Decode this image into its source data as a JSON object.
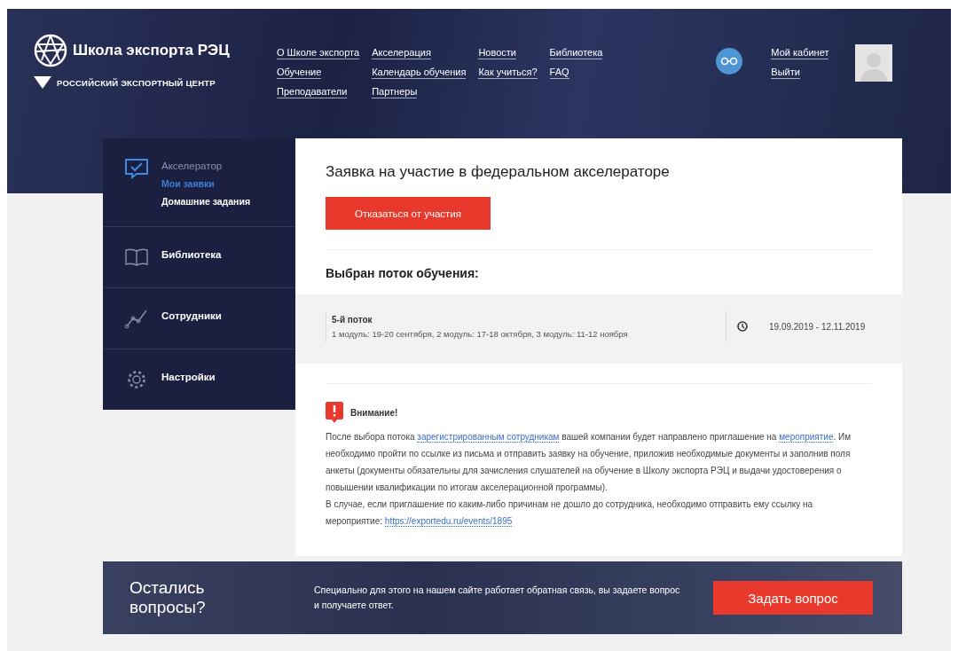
{
  "header": {
    "logo_title": "Школа экспорта РЭЦ",
    "logo_subtitle": "РОССИЙСКИЙ ЭКСПОРТНЫЙ ЦЕНТР",
    "nav_columns": [
      [
        "О Школе экспорта",
        "Обучение",
        "Преподаватели"
      ],
      [
        "Акселерация",
        "Календарь обучения",
        "Партнеры"
      ],
      [
        "Новости",
        "Как учиться?"
      ],
      [
        "Библиотека",
        "FAQ"
      ]
    ],
    "user_links": [
      "Мой кабинет",
      "Выйти"
    ]
  },
  "sidebar": {
    "items": [
      {
        "label": "Акселератор",
        "selected": true,
        "children": [
          {
            "label": "Мои заявки",
            "selected": true
          },
          {
            "label": "Домашние задания",
            "selected": false
          }
        ]
      },
      {
        "label": "Библиотека",
        "selected": false
      },
      {
        "label": "Сотрудники",
        "selected": false
      },
      {
        "label": "Настройки",
        "selected": false
      }
    ]
  },
  "main": {
    "title": "Заявка на участие в федеральном акселераторе",
    "cancel_button": "Отказаться от участия",
    "stream_heading": "Выбран поток обучения:",
    "stream": {
      "name": "5-й поток",
      "modules": "1 модуль: 19-20 сентября, 2 модуль: 17-18 октября, 3 модуль: 11-12 ноября",
      "dates": "19.09.2019 - 12.11.2019"
    },
    "notice": {
      "title": "Внимание!",
      "paragraphs": [
        [
          {
            "text": "После выбора потока "
          },
          {
            "text": "зарегистрированным сотрудникам",
            "link": true
          },
          {
            "text": " вашей компании будет направлено приглашение на "
          },
          {
            "text": "мероприятие",
            "link": true
          },
          {
            "text": ". Им необходимо пройти по ссылке из письма и отправить заявку на обучение, приложив необходимые документы и заполнив поля анкеты (документы обязательны для зачисления слушателей на обучение в Школу экспорта РЭЦ и выдачи удостоверения о повышении квалификации по итогам акселерационной программы)."
          }
        ],
        [
          {
            "text": "В случае, если приглашение по каким-либо причинам не дошло до сотрудника, необходимо отправить ему ссылку на мероприятие: "
          },
          {
            "text": "https://exportedu.ru/events/1895",
            "link": true
          }
        ]
      ]
    }
  },
  "banner": {
    "title": "Остались вопросы?",
    "text": "Специально для этого на нашем сайте работает обратная связь, вы задаете вопрос и получаете ответ.",
    "button": "Задать вопрос"
  }
}
